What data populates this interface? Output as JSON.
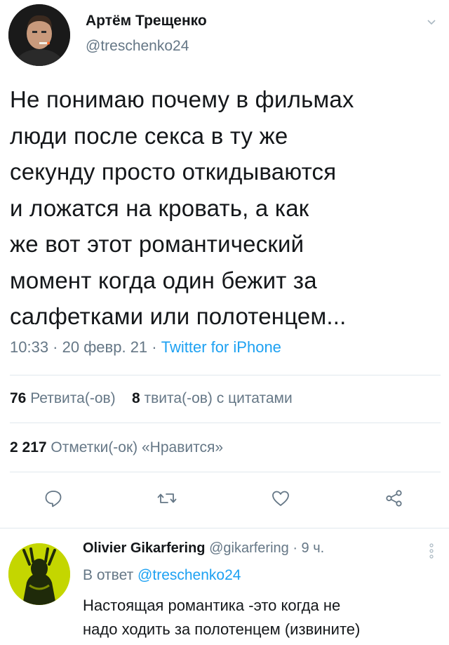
{
  "tweet": {
    "author_name": "Артём Трещенко",
    "author_handle": "@treschenko24",
    "text_lines": [
      "Не понимаю почему в фильмах",
      "люди после секса в ту же",
      "секунду просто откидываются",
      "и ложатся на кровать, а как",
      "же вот этот романтический",
      "момент когда один бежит за",
      "салфетками или полотенцем..."
    ],
    "time": "10:33",
    "date": "20 февр. 21",
    "source": "Twitter for iPhone",
    "separator": " · "
  },
  "stats": {
    "retweets_count": "76",
    "retweets_label": "Ретвита(-ов)",
    "quotes_count": "8",
    "quotes_label": "твита(-ов) с цитатами",
    "likes_count": "2 217",
    "likes_label": "Отметки(-ок) «Нравится»"
  },
  "actions": {
    "icons": [
      "reply-icon",
      "retweet-icon",
      "like-icon",
      "share-icon"
    ]
  },
  "reply": {
    "author_name": "Olivier Gikarfering",
    "author_handle": "@gikarfering",
    "age": "9 ч.",
    "replying_to_prefix": "В ответ",
    "replying_to_handle": "@treschenko24",
    "text_lines": [
      "Настоящая романтика -это когда не",
      "надо ходить за полотенцем (извините)"
    ]
  },
  "colors": {
    "primary_text": "#14171a",
    "secondary_text": "#657786",
    "link": "#1da1f2",
    "divider": "#e1e8ed"
  }
}
